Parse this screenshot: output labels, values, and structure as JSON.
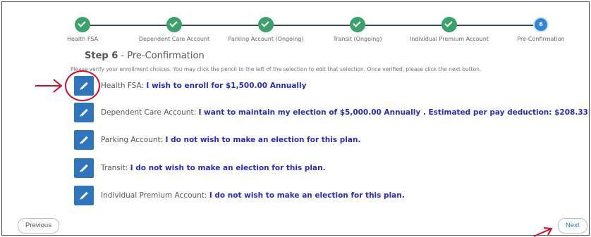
{
  "stepper": {
    "steps": [
      {
        "label": "Health FSA",
        "state": "complete"
      },
      {
        "label": "Dependent Care Account",
        "state": "complete"
      },
      {
        "label": "Parking Account (Ongoing)",
        "state": "complete"
      },
      {
        "label": "Transit (Ongoing)",
        "state": "complete"
      },
      {
        "label": "Individual Premium Account",
        "state": "complete"
      },
      {
        "label": "Pre-Confirmation",
        "state": "current",
        "number": "6"
      }
    ]
  },
  "page": {
    "step_prefix": "Step 6",
    "step_title": " - Pre-Confirmation",
    "instructions": "Please verify your enrollment choices. You may click the pencil to the left of the selection to edit that selection. Once verified, please click the next button."
  },
  "selections": [
    {
      "label": "Health FSA: ",
      "value": "I wish to enroll for $1,500.00 Annually"
    },
    {
      "label": "Dependent Care Account: ",
      "value": "I want to maintain my election of $5,000.00 Annually . Estimated per pay deduction: $208.33"
    },
    {
      "label": "Parking Account: ",
      "value": "I do not wish to make an election for this plan."
    },
    {
      "label": "Transit: ",
      "value": "I do not wish to make an election for this plan."
    },
    {
      "label": "Individual Premium Account: ",
      "value": "I do not wish to make an election for this plan."
    }
  ],
  "nav": {
    "previous_label": "Previous",
    "next_label": "Next"
  },
  "colors": {
    "complete": "#3aa36b",
    "current": "#2d86d6",
    "edit_button": "#2f75bb",
    "value_text": "#2a2ab8",
    "annotation": "#c8102e"
  },
  "icons": {
    "step_complete": "check-icon",
    "edit": "pencil-icon"
  }
}
